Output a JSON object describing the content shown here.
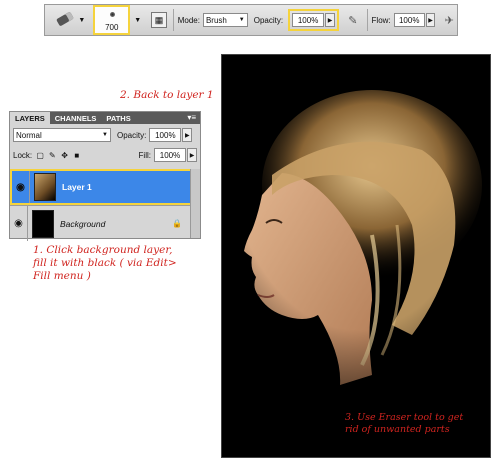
{
  "options_bar": {
    "brush_size": "700",
    "mode_label": "Mode:",
    "mode_value": "Brush",
    "opacity_label": "Opacity:",
    "opacity_value": "100%",
    "flow_label": "Flow:",
    "flow_value": "100%",
    "tool_icon": "eraser-icon",
    "highlight_color": "#f5d33c"
  },
  "annotations": {
    "back_to_layer": "2. Back to layer 1",
    "fill_black_1": "1. Click background layer,",
    "fill_black_2": "fill it with black ( via Edit>",
    "fill_black_3": "Fill menu )",
    "eraser_1": "3. Use Eraser tool to get",
    "eraser_2": "rid of unwanted parts",
    "color": "#d0241f"
  },
  "layers_panel": {
    "tabs": [
      "LAYERS",
      "CHANNELS",
      "PATHS"
    ],
    "blend_mode": "Normal",
    "opacity_label": "Opacity:",
    "opacity_value": "100%",
    "lock_label": "Lock:",
    "fill_label": "Fill:",
    "fill_value": "100%",
    "layers": [
      {
        "name": "Layer 1",
        "selected": true
      },
      {
        "name": "Background",
        "selected": false,
        "locked": true
      }
    ],
    "selection_color": "#3c87e8"
  }
}
